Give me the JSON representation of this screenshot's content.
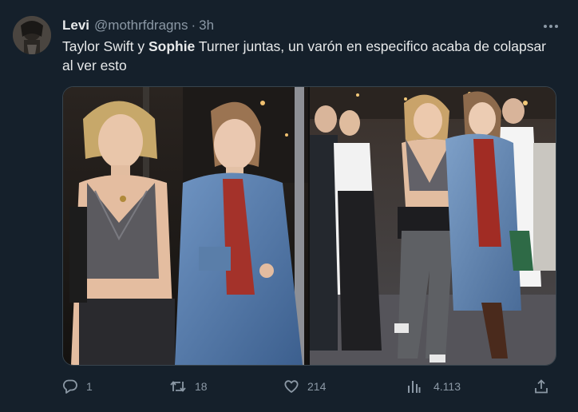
{
  "tweet": {
    "author_name": "Levi",
    "handle": "@mothrfdragns",
    "separator": "·",
    "time": "3h",
    "text_parts": {
      "p1": "Taylor Swift y ",
      "p2": "Sophie",
      "p3": " Turner juntas, un varón en especifico acaba de colapsar al ver esto"
    }
  },
  "actions": {
    "reply_count": "1",
    "retweet_count": "18",
    "like_count": "214",
    "view_count": "4.113"
  },
  "icons": {
    "more": "more-horizontal-icon",
    "reply": "reply-bubble-icon",
    "retweet": "retweet-icon",
    "like": "heart-icon",
    "views": "bar-chart-icon",
    "share": "share-upload-icon"
  },
  "colors": {
    "background": "#15202b",
    "text": "#e7e9ea",
    "secondary": "#8b98a5",
    "border": "#38444d"
  }
}
